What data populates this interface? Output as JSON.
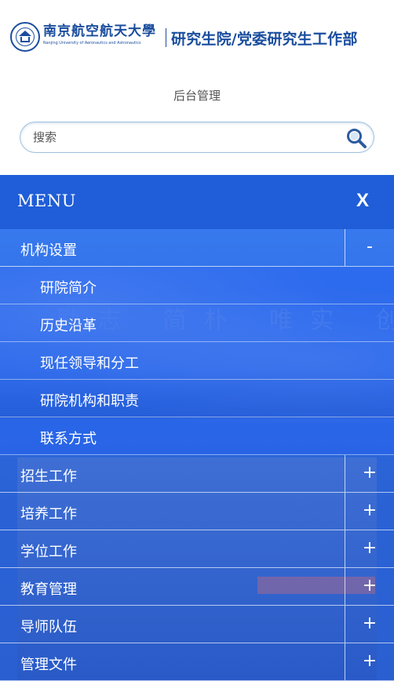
{
  "header": {
    "university_cn": "南京航空航天大學",
    "university_en": "Nanjing University of Aeronautics and Astronautics",
    "department": "研究生院/党委研究生工作部",
    "admin_link": "后台管理"
  },
  "search": {
    "placeholder": "搜索",
    "icon": "search-icon"
  },
  "menu": {
    "title": "MENU",
    "close_label": "X",
    "items": [
      {
        "label": "机构设置",
        "toggle": "-",
        "expanded": true,
        "children": [
          "研院简介",
          "历史沿革",
          "现任领导和分工",
          "研院机构和职责",
          "联系方式"
        ]
      },
      {
        "label": "招生工作",
        "toggle": "+"
      },
      {
        "label": "培养工作",
        "toggle": "+"
      },
      {
        "label": "学位工作",
        "toggle": "+"
      },
      {
        "label": "教育管理",
        "toggle": "+"
      },
      {
        "label": "导师队伍",
        "toggle": "+"
      },
      {
        "label": "管理文件",
        "toggle": "+"
      }
    ]
  },
  "colors": {
    "brand": "#1a4d9e",
    "menu_header": "#1f5ed8",
    "menu_bg": "#2f6fe6"
  }
}
